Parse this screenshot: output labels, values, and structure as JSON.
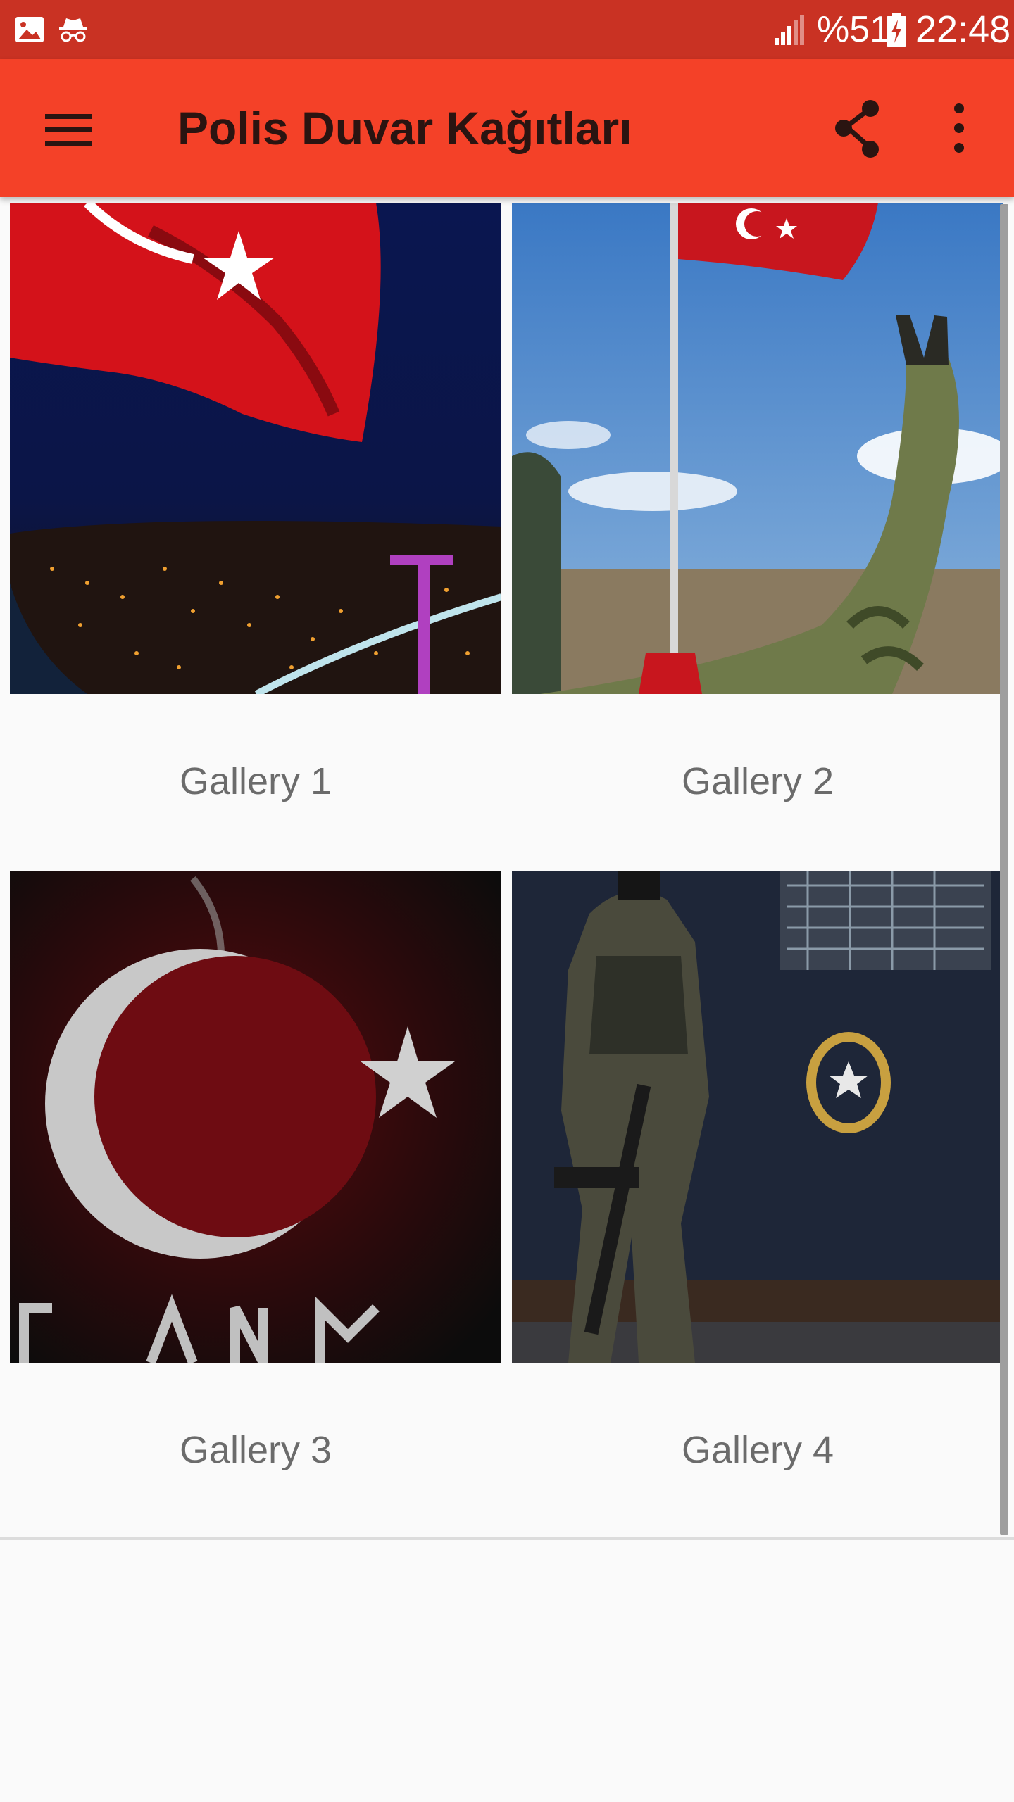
{
  "status_bar": {
    "icons": [
      "gallery-icon",
      "incognito-icon",
      "signal-icon",
      "battery-charging-icon"
    ],
    "battery": "%51",
    "time": "22:48"
  },
  "app_bar": {
    "title": "Polis Duvar Kağıtları",
    "icons": [
      "menu-icon",
      "share-icon",
      "more-vert-icon"
    ],
    "background": "#f44128",
    "status_background": "#c93223"
  },
  "galleries": [
    {
      "label": "Gallery 1"
    },
    {
      "label": "Gallery 2"
    },
    {
      "label": "Gallery 3"
    },
    {
      "label": "Gallery 4"
    }
  ]
}
